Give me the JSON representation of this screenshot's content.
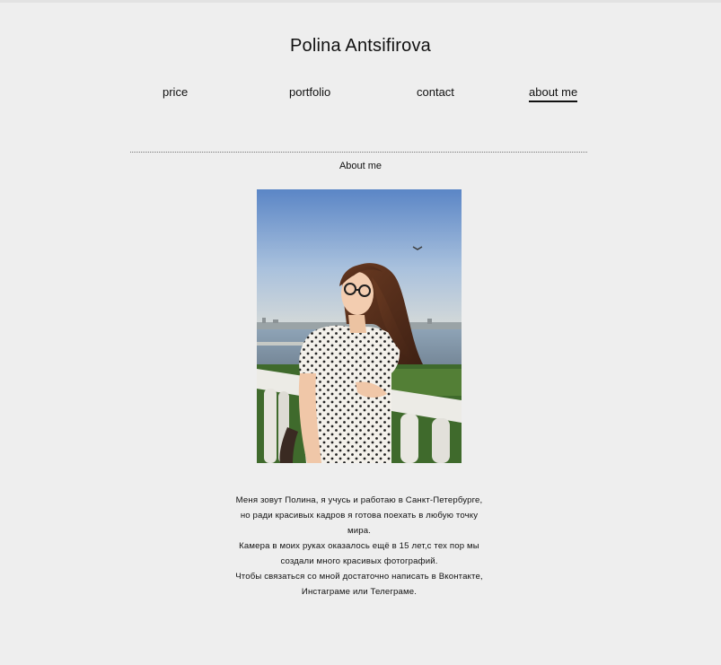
{
  "header": {
    "title": "Polina Antsifirova"
  },
  "nav": {
    "items": [
      {
        "label": "price"
      },
      {
        "label": "portfolio"
      },
      {
        "label": "contact"
      },
      {
        "label": "about me"
      }
    ],
    "active": "about me"
  },
  "main": {
    "heading": "About me",
    "photo": {
      "subject": "portrait-photo"
    },
    "bio": [
      "Меня зовут Полина, я учусь и работаю в Санкт-Петербурге,",
      "но ради красивых кадров я готова поехать в любую точку",
      "мира.",
      "Камера в моих руках оказалось ещё в 15 лет,с тех пор мы",
      "создали много красивых фотографий.",
      "Чтобы связаться со мной достаточно  написать в Вконтакте,",
      "Инстаграме или Телеграме."
    ]
  },
  "colors": {
    "background": "#eeeeee",
    "text": "#111111",
    "accent_underline": "#111111"
  }
}
